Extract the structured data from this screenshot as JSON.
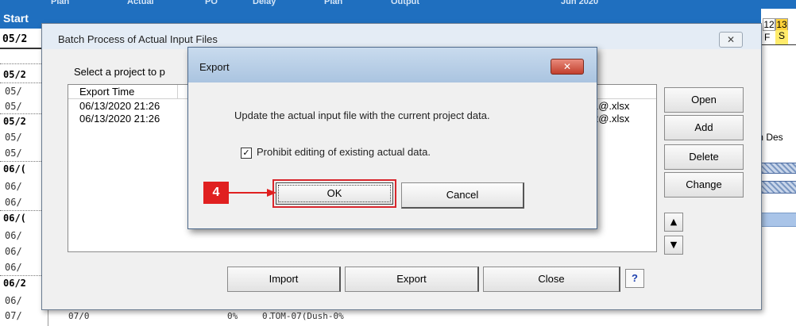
{
  "spreadsheet": {
    "header_top": [
      "Plan",
      "Actual",
      "PO",
      "Delay",
      "Plan",
      "Output",
      "Jun 2020"
    ],
    "start_label": "Start",
    "first_date": "05/2",
    "rows": [
      {
        "text": "05/2",
        "bold": true
      },
      {
        "text": "05/",
        "bold": false
      },
      {
        "text": "05/",
        "bold": false
      },
      {
        "text": "05/2",
        "bold": true
      },
      {
        "text": "05/",
        "bold": false
      },
      {
        "text": "05/",
        "bold": false
      },
      {
        "text": "06/(",
        "bold": true
      },
      {
        "text": "06/",
        "bold": false
      },
      {
        "text": "06/",
        "bold": false
      },
      {
        "text": "06/(",
        "bold": true
      },
      {
        "text": "06/",
        "bold": false
      },
      {
        "text": "06/",
        "bold": false
      },
      {
        "text": "06/",
        "bold": false
      },
      {
        "text": "06/2",
        "bold": true
      },
      {
        "text": "06/",
        "bold": false
      },
      {
        "text": "07/",
        "bold": false
      }
    ],
    "gantt_day_12": "12",
    "gantt_day_13": "13",
    "gantt_weekday_f": "F",
    "gantt_weekday_s": "S",
    "side_text": "m Des",
    "bottom_row": [
      "07/0",
      "0%",
      "0.",
      "TOM-07(Dush-0%"
    ]
  },
  "batch_dialog": {
    "title": "Batch Process of Actual Input Files",
    "close_glyph": "✕",
    "prompt": "Select a project to p",
    "list_header": "Export Time",
    "items": [
      {
        "time": "06/13/2020 21:26",
        "file": "1@.xlsx"
      },
      {
        "time": "06/13/2020 21:26",
        "file": "2@.xlsx"
      }
    ],
    "buttons": {
      "open": "Open",
      "add": "Add",
      "delete": "Delete",
      "change": "Change",
      "import": "Import",
      "export": "Export",
      "close": "Close",
      "help": "?"
    },
    "up_arrow": "▲",
    "down_arrow": "▼"
  },
  "export_dialog": {
    "title": "Export",
    "close_glyph": "✕",
    "message": "Update the actual input file with the current project data.",
    "checkbox_label": "Prohibit editing of existing actual data.",
    "checkbox_checked": true,
    "checkbox_mark": "✓",
    "ok": "OK",
    "cancel": "Cancel"
  },
  "callout": {
    "step": "4",
    "color": "#e02020"
  }
}
